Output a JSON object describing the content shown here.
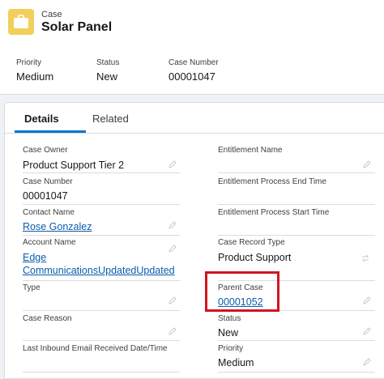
{
  "header": {
    "object_type": "Case",
    "title": "Solar Panel",
    "icon": "case-icon",
    "icon_color": "#f2cf5b",
    "highlights": [
      {
        "label": "Priority",
        "value": "Medium"
      },
      {
        "label": "Status",
        "value": "New"
      },
      {
        "label": "Case Number",
        "value": "00001047"
      }
    ]
  },
  "tabs": [
    {
      "label": "Details",
      "active": true
    },
    {
      "label": "Related",
      "active": false
    }
  ],
  "fields": {
    "case_owner": {
      "label": "Case Owner",
      "value": "Product Support Tier 2"
    },
    "case_number": {
      "label": "Case Number",
      "value": "00001047"
    },
    "contact_name": {
      "label": "Contact Name",
      "value": "Rose Gonzalez"
    },
    "account_name": {
      "label": "Account Name",
      "value_line1": "Edge",
      "value_line2": "CommunicationsUpdatedUpdated"
    },
    "type": {
      "label": "Type",
      "value": ""
    },
    "case_reason": {
      "label": "Case Reason",
      "value": ""
    },
    "last_inbound_email": {
      "label": "Last Inbound Email Received Date/Time",
      "value": ""
    },
    "entitlement_name": {
      "label": "Entitlement Name",
      "value": ""
    },
    "entitlement_end": {
      "label": "Entitlement Process End Time",
      "value": ""
    },
    "entitlement_start": {
      "label": "Entitlement Process Start Time",
      "value": ""
    },
    "case_record_type": {
      "label": "Case Record Type",
      "value": "Product Support"
    },
    "parent_case": {
      "label": "Parent Case",
      "value": "00001052"
    },
    "status": {
      "label": "Status",
      "value": "New"
    },
    "priority": {
      "label": "Priority",
      "value": "Medium"
    }
  },
  "colors": {
    "link": "#0b5cab",
    "tab_accent": "#0176d3",
    "highlight_box": "#d0161f"
  }
}
